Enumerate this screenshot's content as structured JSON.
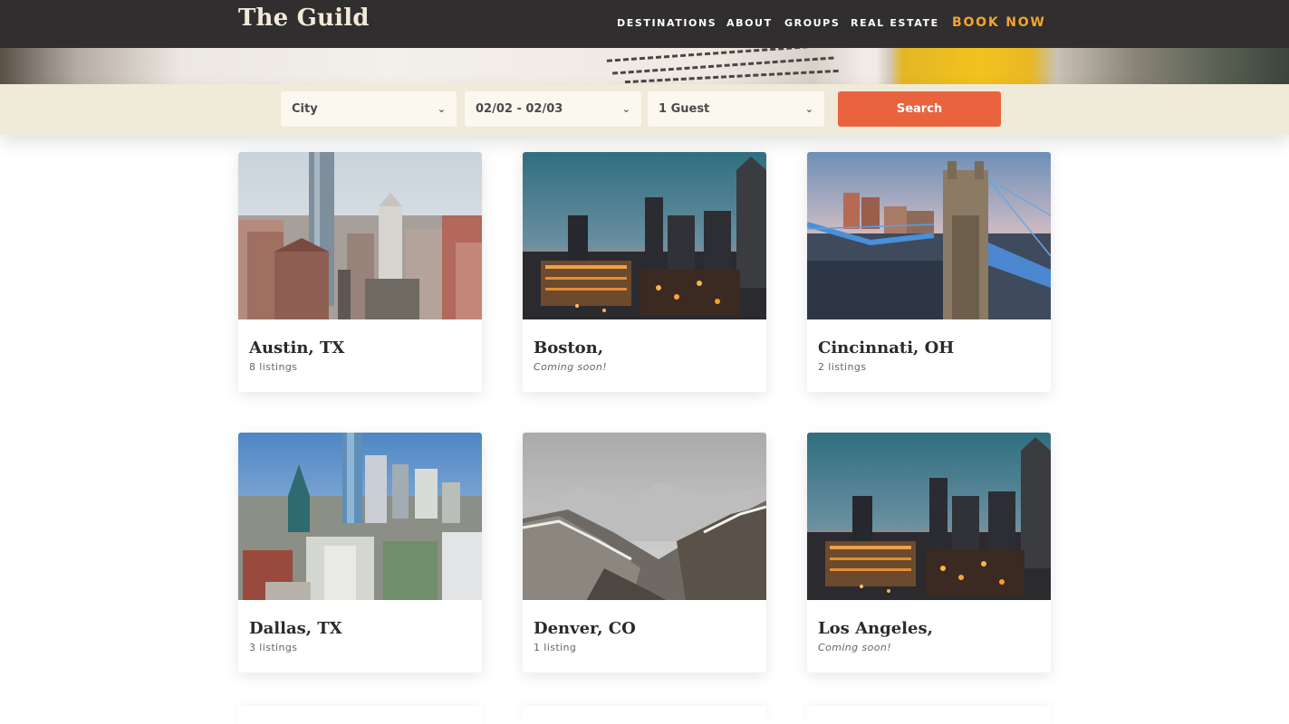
{
  "header": {
    "logo": "The Guild",
    "nav": [
      {
        "label": "DESTINATIONS"
      },
      {
        "label": "ABOUT"
      },
      {
        "label": "GROUPS"
      },
      {
        "label": "REAL ESTATE"
      }
    ],
    "cta": "BOOK NOW"
  },
  "search": {
    "city": "City",
    "dates": "02/02 - 02/03",
    "guests": "1 Guest",
    "button": "Search"
  },
  "destinations": [
    {
      "name": "Austin, TX",
      "subtitle": "8 listings"
    },
    {
      "name": "Boston,",
      "subtitle": "Coming soon!"
    },
    {
      "name": "Cincinnati, OH",
      "subtitle": "2 listings"
    },
    {
      "name": "Dallas, TX",
      "subtitle": "3 listings"
    },
    {
      "name": "Denver, CO",
      "subtitle": "1 listing"
    },
    {
      "name": "Los Angeles,",
      "subtitle": "Coming soon!"
    }
  ],
  "colors": {
    "header_bg": "#302e2e",
    "accent_orange": "#f4a52b",
    "search_button": "#e9643e",
    "search_bar_bg": "#f0ead8"
  }
}
